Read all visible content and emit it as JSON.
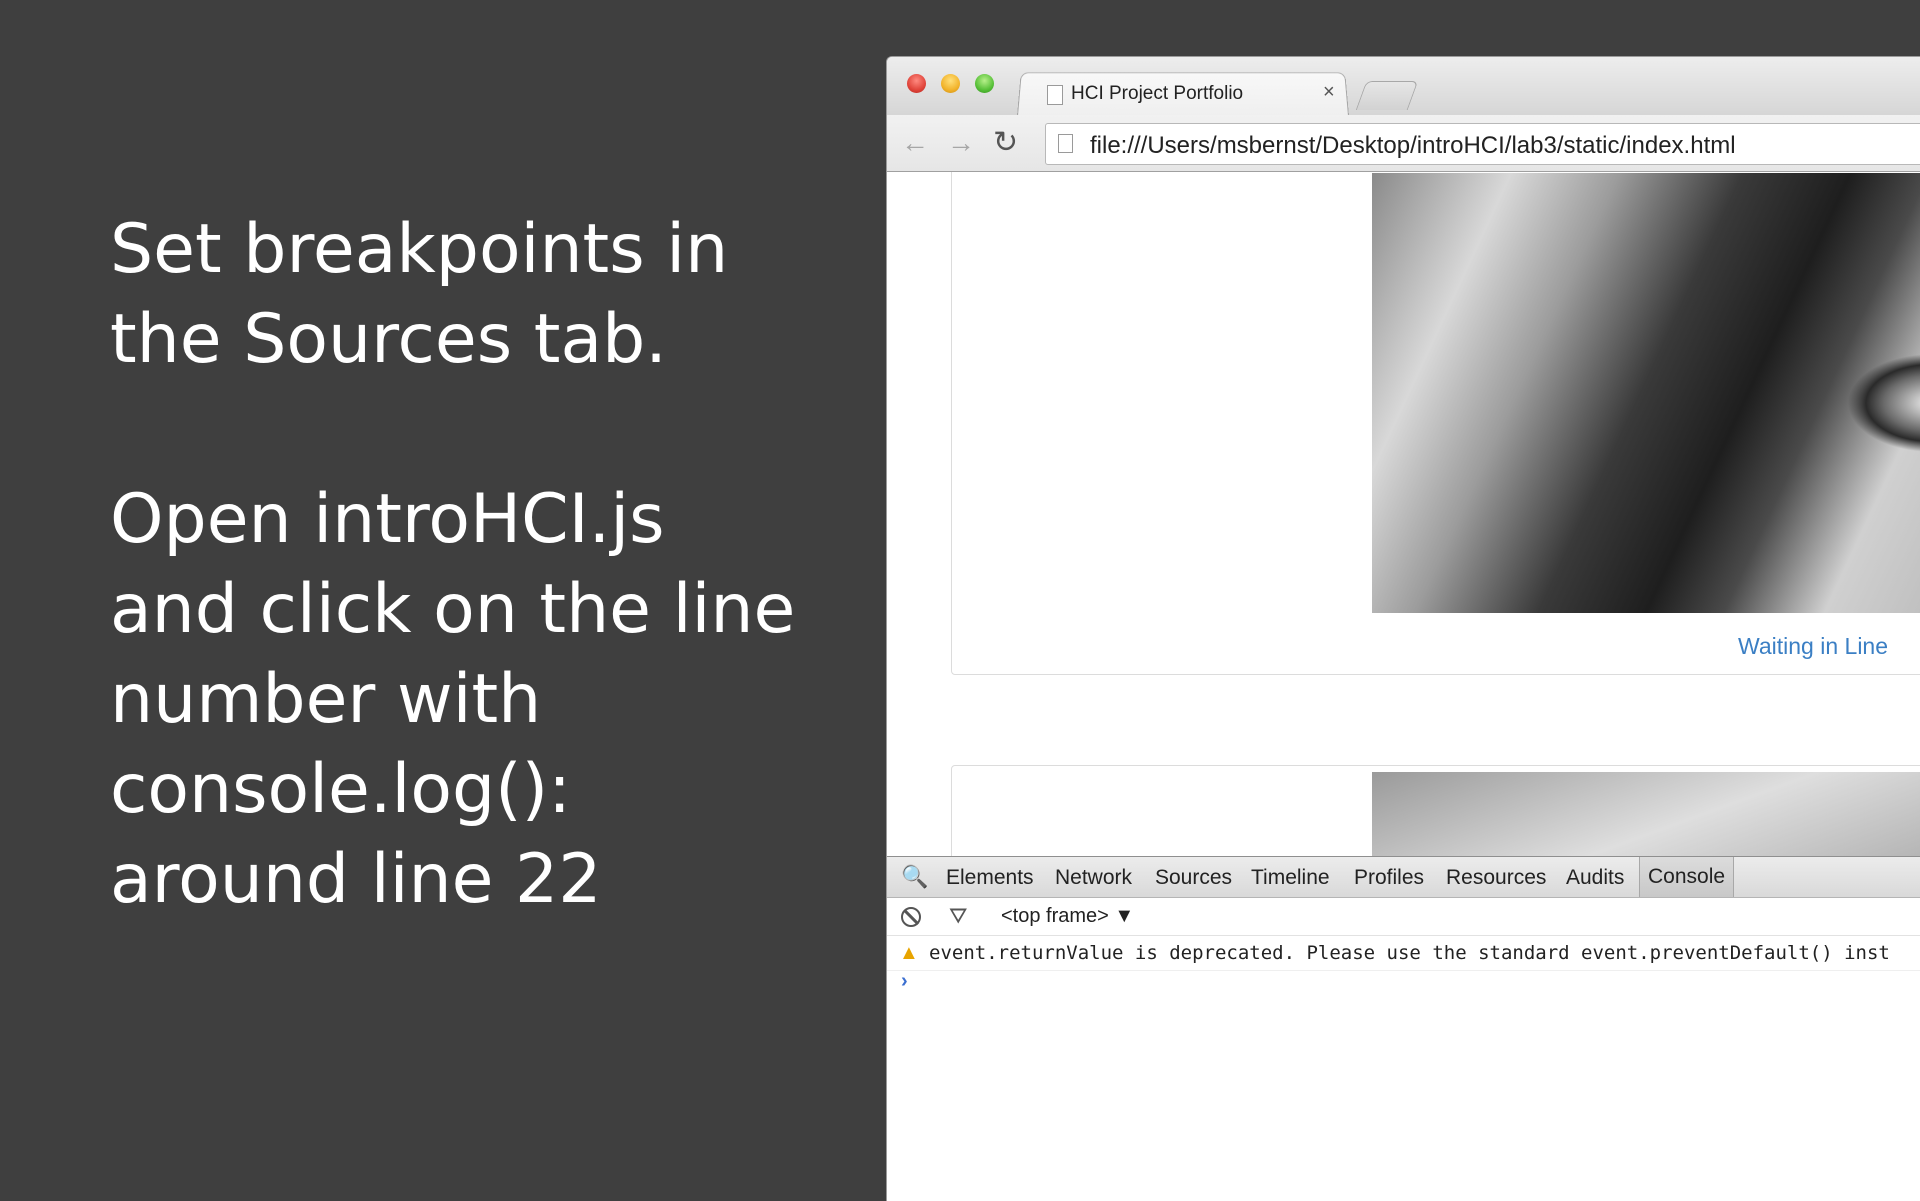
{
  "slide": {
    "para1_line1": "Set breakpoints in",
    "para1_line2": "the Sources tab.",
    "para2_line1": "Open introHCI.js",
    "para2_line2": "and click on the line",
    "para2_line3": "number with",
    "para2_line4": "console.log():",
    "para2_line5": "around line 22"
  },
  "browser": {
    "tab_title": "HCI Project Portfolio",
    "tab_close": "×",
    "back": "←",
    "forward": "→",
    "reload": "↻",
    "url": "file:///Users/msbernst/Desktop/introHCI/lab3/static/index.html",
    "photo_caption": "Waiting in Line"
  },
  "devtools": {
    "search_icon": "🔍",
    "tabs": [
      "Elements",
      "Network",
      "Sources",
      "Timeline",
      "Profiles",
      "Resources",
      "Audits",
      "Console"
    ],
    "active_tab": "Console",
    "filter_icon": "⛛",
    "frame": "<top frame> ▼",
    "warning_icon": "▲",
    "message": "event.returnValue is deprecated. Please use the standard event.preventDefault() inst",
    "prompt": "›"
  },
  "colors": {
    "slide_bg": "#3f3f3f",
    "link": "#3b7fc4",
    "warning": "#e8a400"
  }
}
